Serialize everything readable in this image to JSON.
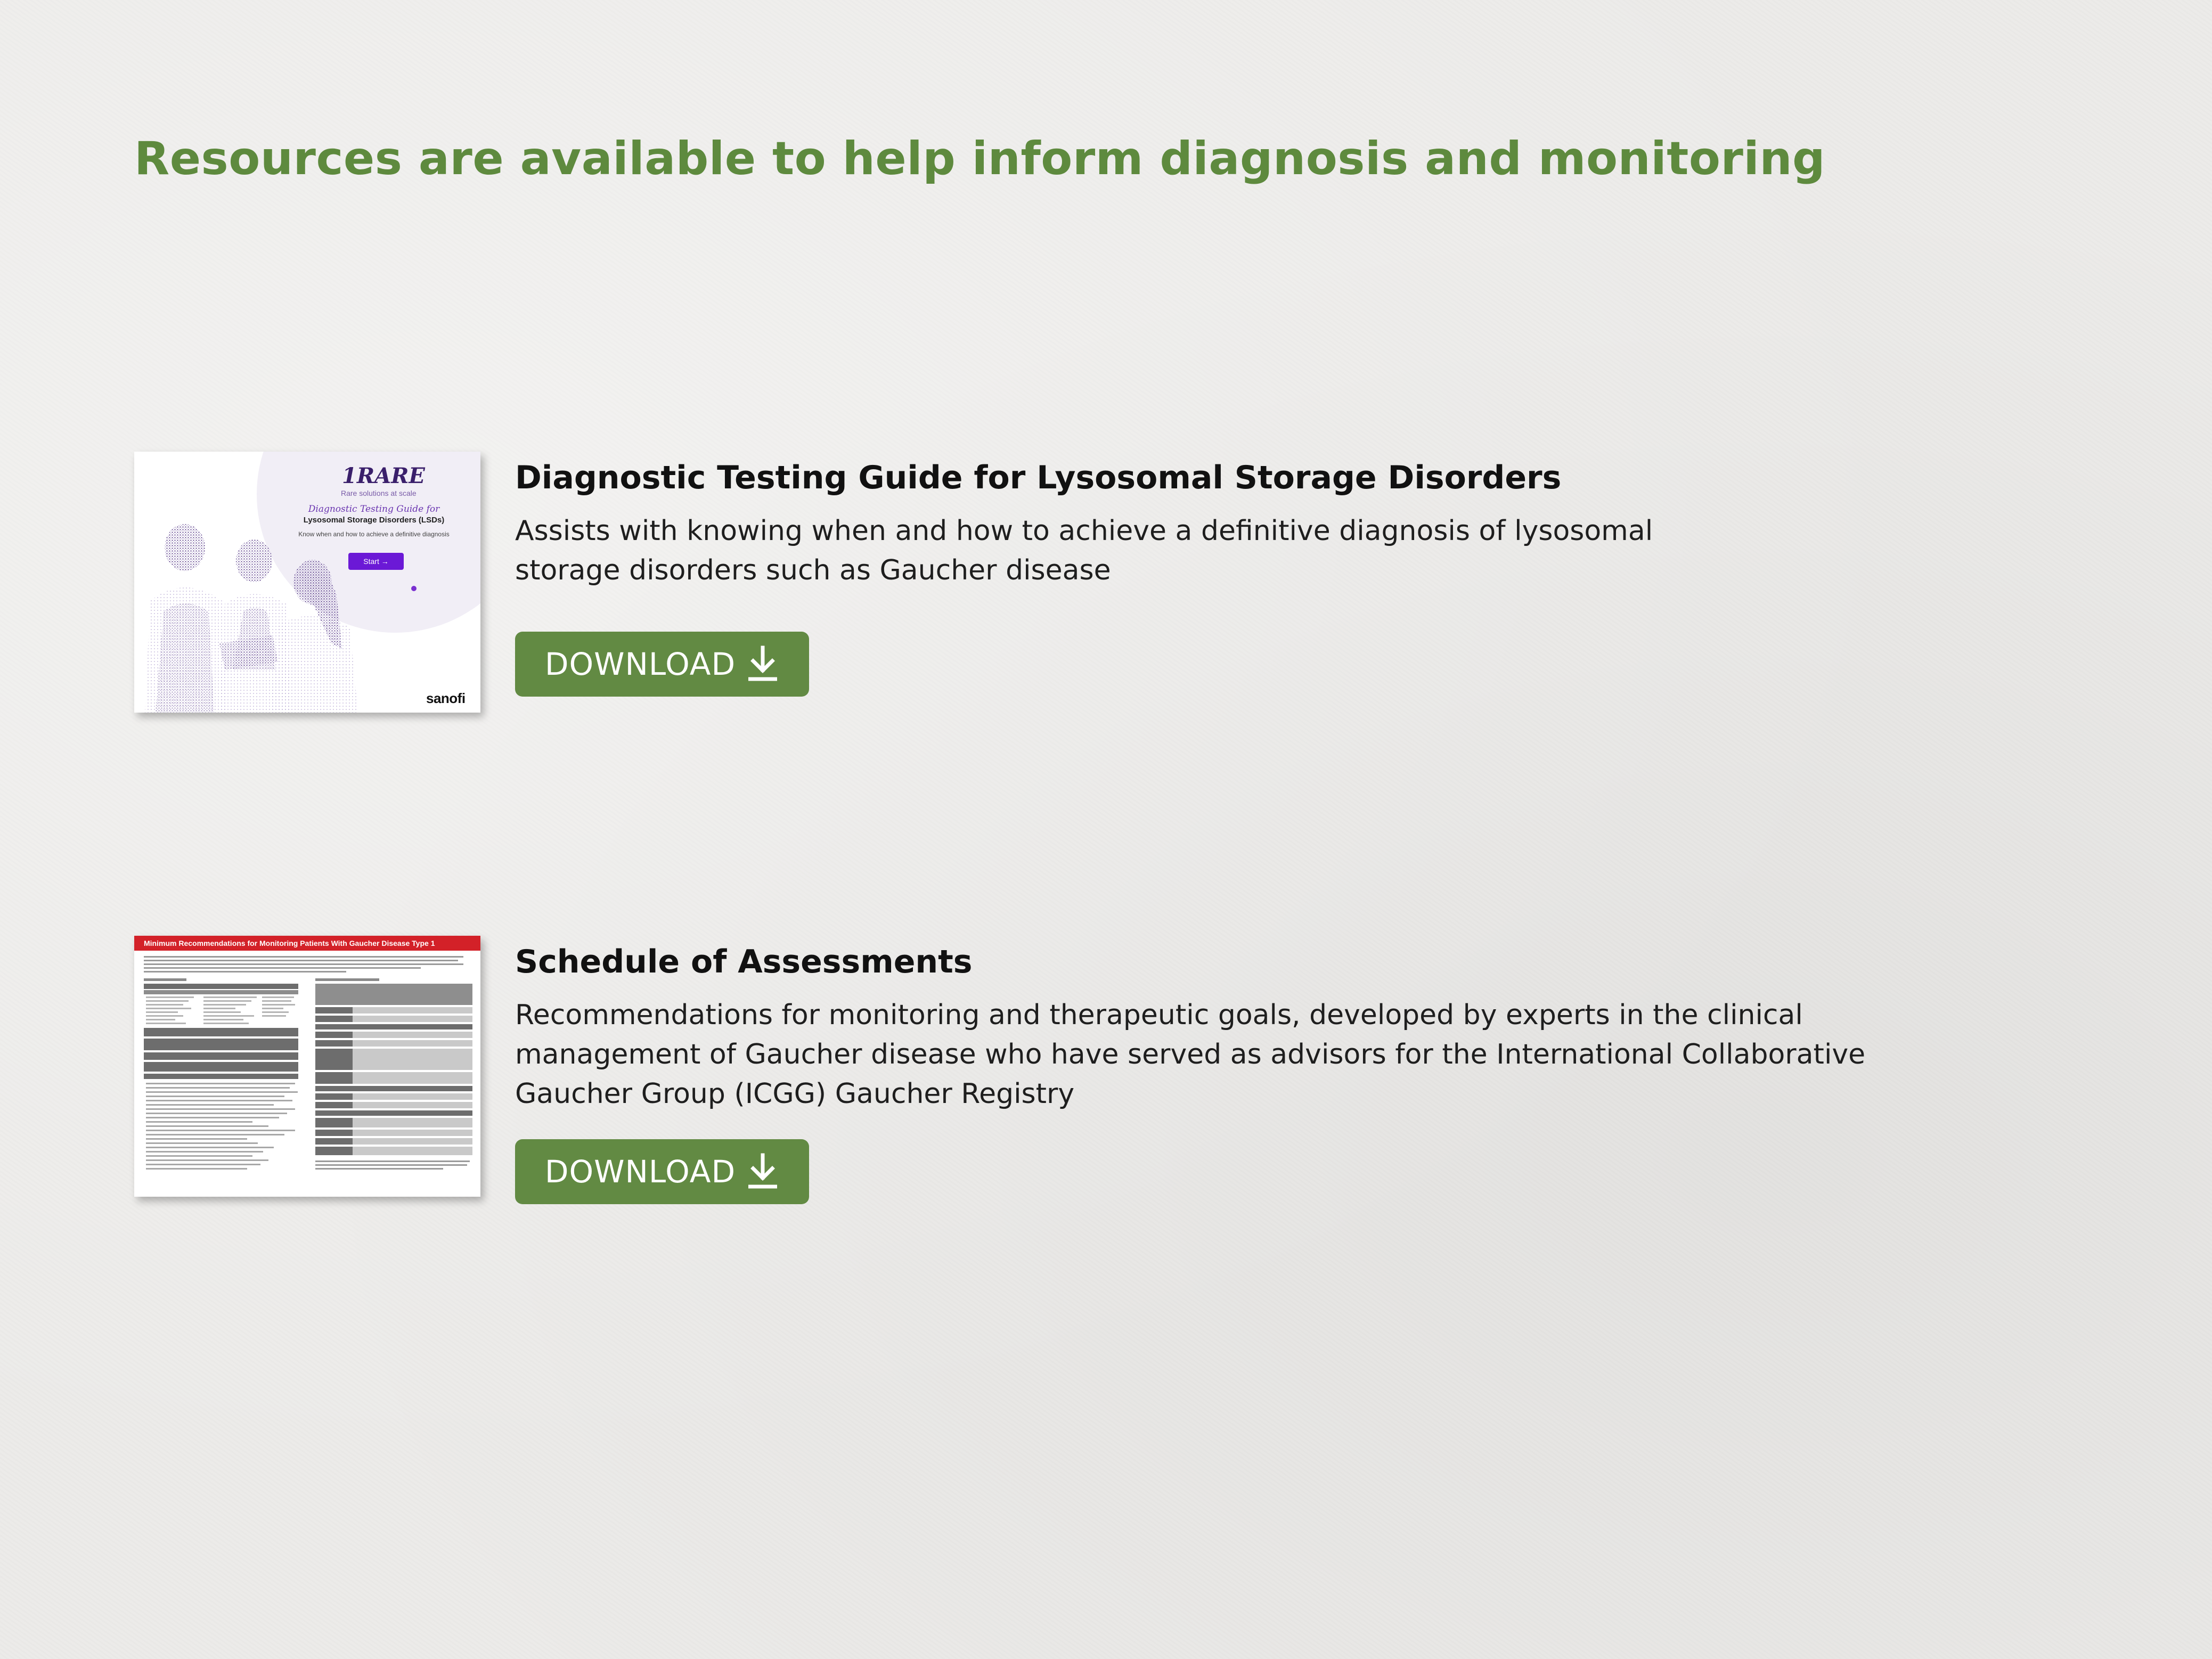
{
  "page": {
    "heading": "Resources are available to help inform diagnosis and monitoring",
    "colors": {
      "heading": "#5e8a3e",
      "button": "#628a43",
      "background": "#ecebe9"
    }
  },
  "resources": [
    {
      "title": "Diagnostic Testing Guide for Lysosomal Storage Disorders",
      "description": "Assists with knowing when and how to achieve a definitive diagnosis of lysosomal storage disorders such as Gaucher disease",
      "button_label": "DOWNLOAD",
      "button_icon": "download-icon",
      "thumbnail": {
        "brand": "1RARE",
        "tagline": "Rare solutions at scale",
        "guide_title": "Diagnostic Testing Guide for",
        "guide_subtitle": "Lysosomal Storage Disorders (LSDs)",
        "guide_note": "Know when and how to achieve a definitive diagnosis",
        "start_label": "Start →",
        "logo": "sanofi"
      }
    },
    {
      "title": "Schedule of Assessments",
      "description": "Recommendations for monitoring and therapeutic goals, developed by experts in the clinical management of Gaucher disease who have served as advisors for the International Collaborative Gaucher Group (ICGG) Gaucher Registry",
      "button_label": "DOWNLOAD",
      "button_icon": "download-icon",
      "thumbnail": {
        "banner": "Minimum Recommendations for Monitoring Patients With Gaucher Disease Type 1"
      }
    }
  ]
}
